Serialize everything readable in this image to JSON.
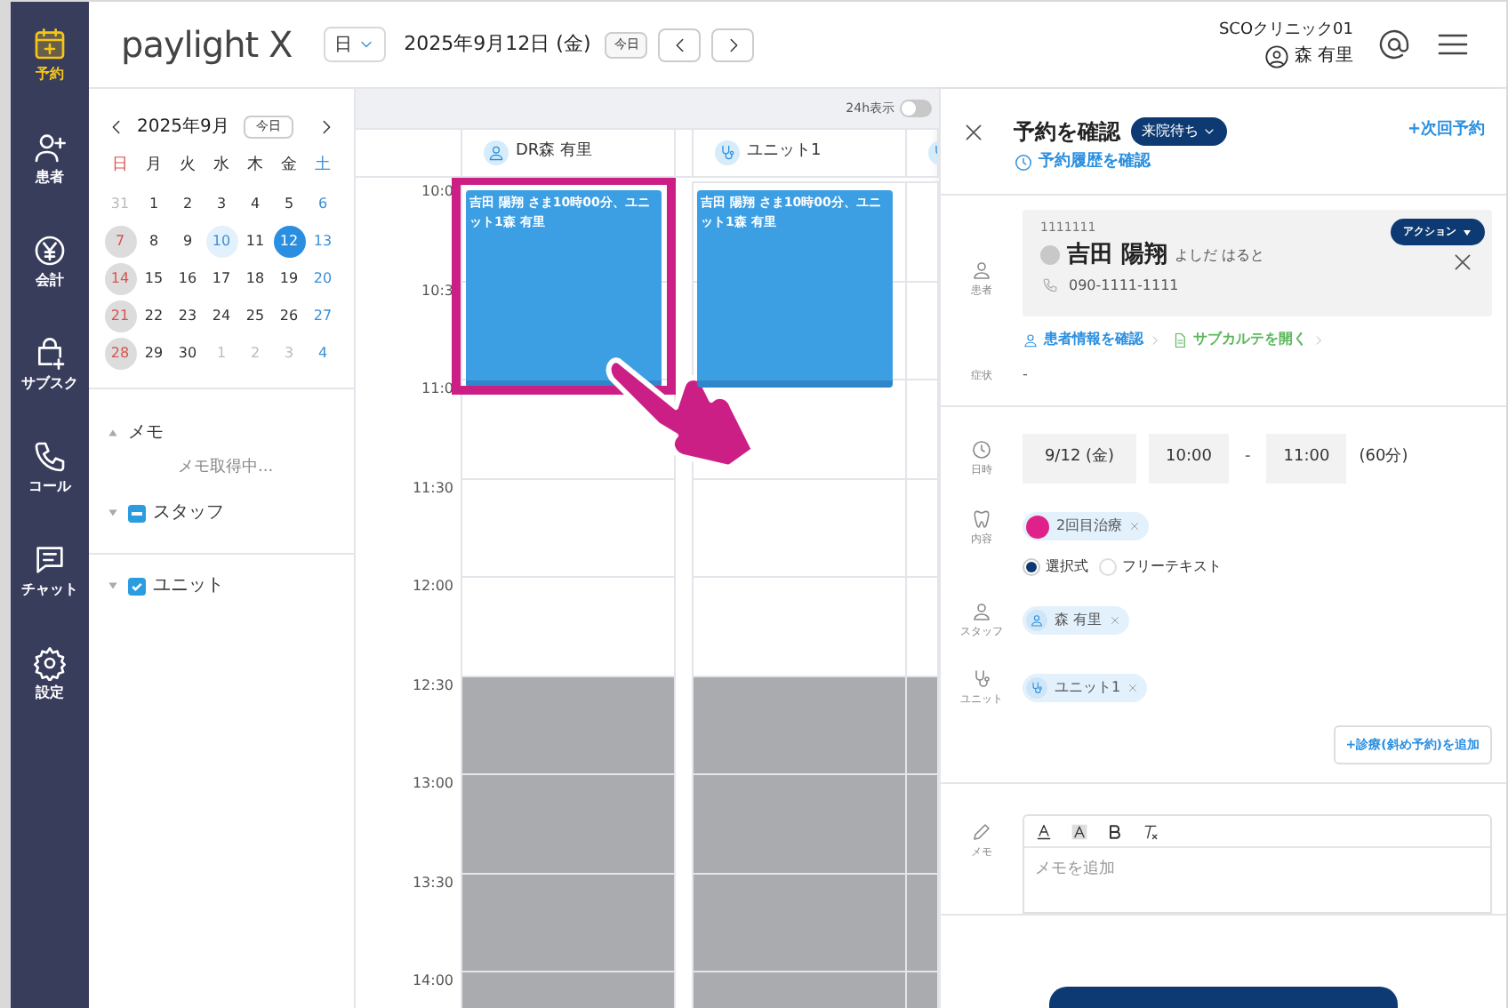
{
  "nav": [
    {
      "label": "予約",
      "selected": true
    },
    {
      "label": "患者",
      "selected": false
    },
    {
      "label": "会計",
      "selected": false
    },
    {
      "label": "サブスク",
      "selected": false
    },
    {
      "label": "コール",
      "selected": false
    },
    {
      "label": "チャット",
      "selected": false
    },
    {
      "label": "設定",
      "selected": false
    }
  ],
  "header": {
    "logo": "paylight X",
    "view": "日",
    "date": "2025年9月12日 (金)",
    "today": "今日",
    "clinic": "SCOクリニック01",
    "user": "森 有里"
  },
  "mini_calendar": {
    "title": "2025年9月",
    "today": "今日",
    "weekdays": [
      "日",
      "月",
      "火",
      "水",
      "木",
      "金",
      "土"
    ],
    "weeks": [
      [
        {
          "text": "31",
          "kind": "outside",
          "selected": false
        },
        {
          "text": "1",
          "kind": "normal",
          "selected": false
        },
        {
          "text": "2",
          "kind": "normal",
          "selected": false
        },
        {
          "text": "3",
          "kind": "normal",
          "selected": false
        },
        {
          "text": "4",
          "kind": "normal",
          "selected": false
        },
        {
          "text": "5",
          "kind": "normal",
          "selected": false
        },
        {
          "text": "6",
          "kind": "normal",
          "selected": false
        }
      ],
      [
        {
          "text": "7",
          "kind": "closed",
          "selected": false
        },
        {
          "text": "8",
          "kind": "normal",
          "selected": false
        },
        {
          "text": "9",
          "kind": "normal",
          "selected": false
        },
        {
          "text": "10",
          "kind": "marked",
          "selected": false
        },
        {
          "text": "11",
          "kind": "normal",
          "selected": false
        },
        {
          "text": "12",
          "kind": "normal",
          "selected": true
        },
        {
          "text": "13",
          "kind": "normal",
          "selected": false
        }
      ],
      [
        {
          "text": "14",
          "kind": "closed",
          "selected": false
        },
        {
          "text": "15",
          "kind": "normal",
          "selected": false
        },
        {
          "text": "16",
          "kind": "normal",
          "selected": false
        },
        {
          "text": "17",
          "kind": "normal",
          "selected": false
        },
        {
          "text": "18",
          "kind": "normal",
          "selected": false
        },
        {
          "text": "19",
          "kind": "normal",
          "selected": false
        },
        {
          "text": "20",
          "kind": "normal",
          "selected": false
        }
      ],
      [
        {
          "text": "21",
          "kind": "closed",
          "selected": false
        },
        {
          "text": "22",
          "kind": "normal",
          "selected": false
        },
        {
          "text": "23",
          "kind": "normal",
          "selected": false
        },
        {
          "text": "24",
          "kind": "normal",
          "selected": false
        },
        {
          "text": "25",
          "kind": "normal",
          "selected": false
        },
        {
          "text": "26",
          "kind": "normal",
          "selected": false
        },
        {
          "text": "27",
          "kind": "normal",
          "selected": false
        }
      ],
      [
        {
          "text": "28",
          "kind": "closed",
          "selected": false
        },
        {
          "text": "29",
          "kind": "normal",
          "selected": false
        },
        {
          "text": "30",
          "kind": "normal",
          "selected": false
        },
        {
          "text": "1",
          "kind": "outside",
          "selected": false
        },
        {
          "text": "2",
          "kind": "outside",
          "selected": false
        },
        {
          "text": "3",
          "kind": "outside",
          "selected": false
        },
        {
          "text": "4",
          "kind": "outside",
          "selected": false
        }
      ]
    ]
  },
  "filters": [
    {
      "kind": "memo",
      "label": "メモ",
      "expanded": true,
      "note": "メモ取得中..."
    },
    {
      "kind": "group",
      "label": "スタッフ",
      "expanded": true,
      "checked": true,
      "indeterminate": true
    },
    {
      "kind": "group",
      "label": "ユニット",
      "expanded": true,
      "checked": true,
      "indeterminate": false
    }
  ],
  "schedule": {
    "toggle": {
      "label": "24h表示",
      "on": false
    },
    "columns": [
      {
        "kind": "staff",
        "name": "DR森 有里",
        "events": [
          {
            "text": "吉田 陽翔 さま10時00分、ユニット1森 有里",
            "highlighted": true
          }
        ]
      },
      {
        "kind": "unit",
        "name": "ユニット1",
        "events": [
          {
            "text": "吉田 陽翔 さま10時00分、ユニット1森 有里",
            "highlighted": false
          }
        ]
      },
      {
        "kind": "unit"
      }
    ],
    "times": [
      {
        "label": "10:0",
        "closed": false
      },
      {
        "label": "10:3",
        "closed": false
      },
      {
        "label": "11:0",
        "closed": false
      },
      {
        "label": "11:30",
        "closed": false
      },
      {
        "label": "12:00",
        "closed": false
      },
      {
        "label": "12:30",
        "closed": true
      },
      {
        "label": "13:00",
        "closed": true
      },
      {
        "label": "13:30",
        "closed": true
      },
      {
        "label": "14:00",
        "closed": true
      }
    ]
  },
  "detail": {
    "title": "予約を確認",
    "status": "来院待ち",
    "next": "+次回予約",
    "history": "予約履歴を確認",
    "patient": {
      "label": "患者",
      "id": "1111111",
      "name": "吉田 陽翔",
      "kana": "よしだ はると",
      "phone": "090-1111-1111",
      "action": "アクション"
    },
    "links": [
      "患者情報を確認",
      "サブカルテを開く"
    ],
    "symptom": {
      "label": "症状",
      "value": "-"
    },
    "datetime": {
      "label": "日時",
      "date": "9/12 (金)",
      "start": "10:00",
      "sep": "-",
      "end": "11:00",
      "duration": "(60分)"
    },
    "content": {
      "label": "内容",
      "tags": [
        {
          "text": "2回目治療",
          "color": "#e0218a"
        }
      ],
      "modes": [
        {
          "label": "選択式",
          "selected": true
        },
        {
          "label": "フリーテキスト",
          "selected": false
        }
      ]
    },
    "staff": {
      "label": "スタッフ",
      "tags": [
        "森 有里"
      ]
    },
    "unit": {
      "label": "ユニット",
      "tags": [
        "ユニット1"
      ]
    },
    "add_button": "+診療(斜め予約)を追加",
    "memo": {
      "label": "メモ",
      "placeholder": "メモを追加"
    }
  }
}
